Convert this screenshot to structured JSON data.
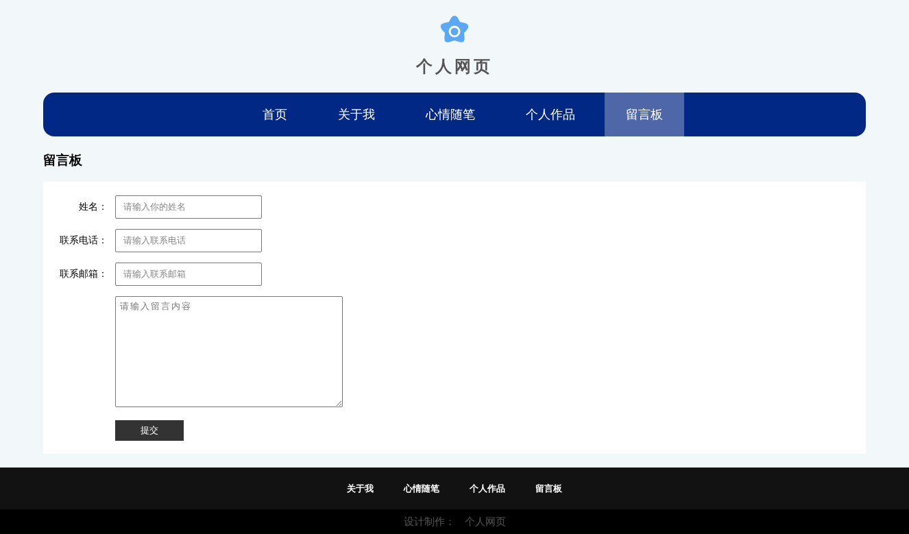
{
  "site": {
    "title": "个人网页"
  },
  "nav": [
    {
      "label": "首页",
      "selected": false
    },
    {
      "label": "关于我",
      "selected": false
    },
    {
      "label": "心情随笔",
      "selected": false
    },
    {
      "label": "个人作品",
      "selected": false
    },
    {
      "label": "留言板",
      "selected": true
    }
  ],
  "section": {
    "heading": "留言板"
  },
  "form": {
    "fields": [
      {
        "label": "姓名：",
        "placeholder": "请输入你的姓名"
      },
      {
        "label": "联系电话：",
        "placeholder": "请输入联系电话"
      },
      {
        "label": "联系邮箱：",
        "placeholder": "请输入联系邮箱"
      }
    ],
    "message": {
      "placeholder": "请输入留言内容"
    },
    "submit": "提交"
  },
  "footer": {
    "links": [
      "关于我",
      "心情随笔",
      "个人作品",
      "留言板"
    ],
    "credit_label": "设计制作：",
    "credit_value": "个人网页"
  }
}
